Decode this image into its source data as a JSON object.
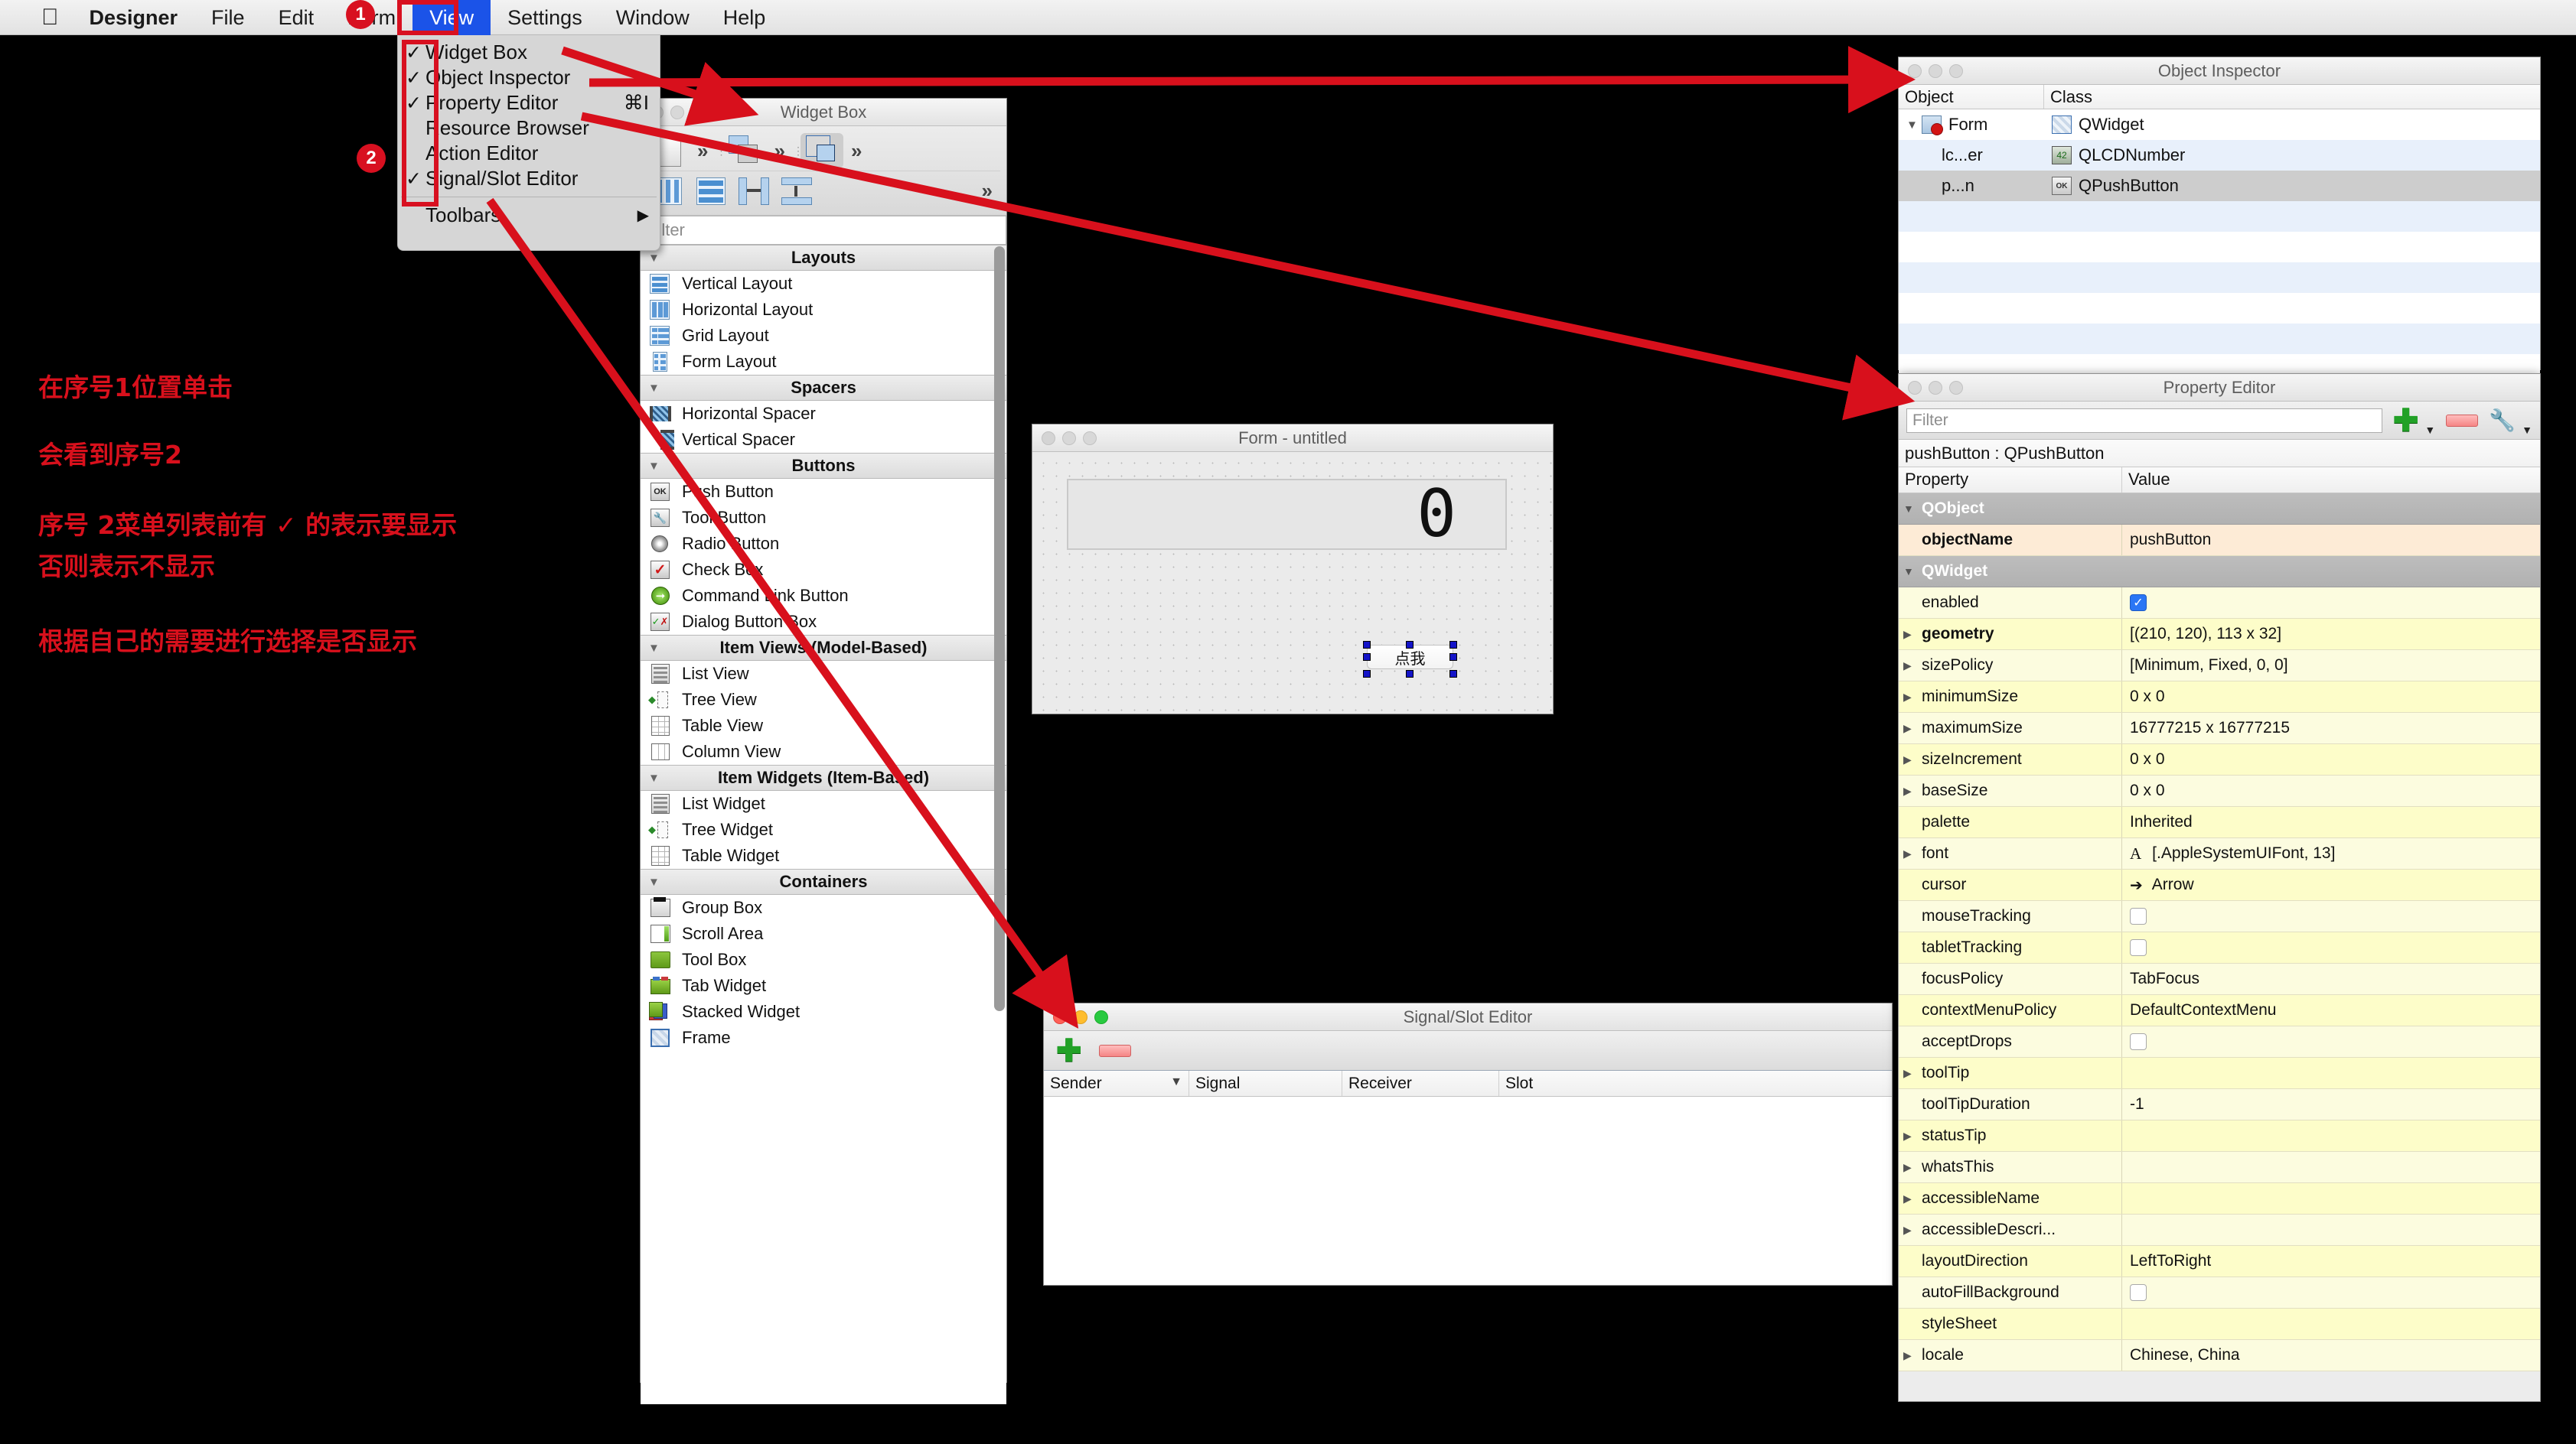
{
  "menubar": {
    "apple_icon": "apple-logo-icon",
    "items": [
      {
        "label": "Designer",
        "bold": true
      },
      {
        "label": "File"
      },
      {
        "label": "Edit"
      },
      {
        "label": "Form"
      },
      {
        "label": "View",
        "selected": true
      },
      {
        "label": "Settings"
      },
      {
        "label": "Window"
      },
      {
        "label": "Help"
      }
    ]
  },
  "badges": {
    "one": "1",
    "two": "2"
  },
  "view_menu": {
    "items": [
      {
        "label": "Widget Box",
        "checked": "✓",
        "shortcut": ""
      },
      {
        "label": "Object Inspector",
        "checked": "✓",
        "shortcut": ""
      },
      {
        "label": "Property Editor",
        "checked": "✓",
        "shortcut": "⌘I"
      },
      {
        "label": "Resource Browser",
        "checked": "",
        "shortcut": ""
      },
      {
        "label": "Action Editor",
        "checked": "",
        "shortcut": ""
      },
      {
        "label": "Signal/Slot Editor",
        "checked": "✓",
        "shortcut": ""
      }
    ],
    "submenu": {
      "label": "Toolbars",
      "arrow": "▶"
    }
  },
  "annotations": {
    "line1": "在序号1位置单击",
    "line2": "会看到序号2",
    "line3": "序号 2菜单列表前有 ✓ 的表示要显示",
    "line4": "否则表示不显示",
    "line5": "根据自己的需要进行选择是否显示",
    "color": "#d8101c"
  },
  "widget_box": {
    "title": "Widget Box",
    "filter_placeholder": "Filter",
    "toolbar_row1": [
      "new-form-icon",
      "chevron-more-icon",
      "raise-widget-icon",
      "chevron-more-icon",
      "edit-widgets-icon",
      "chevron-more-icon"
    ],
    "toolbar_row2": [
      "horizontal-layout-icon",
      "vertical-layout-icon",
      "split-horizontal-icon",
      "split-vertical-icon",
      "chevron-more-icon"
    ],
    "groups": [
      {
        "name": "Layouts",
        "items": [
          {
            "label": "Vertical Layout",
            "icon": "vertical-layout-icon"
          },
          {
            "label": "Horizontal Layout",
            "icon": "horizontal-layout-icon"
          },
          {
            "label": "Grid Layout",
            "icon": "grid-layout-icon"
          },
          {
            "label": "Form Layout",
            "icon": "form-layout-icon"
          }
        ]
      },
      {
        "name": "Spacers",
        "items": [
          {
            "label": "Horizontal Spacer",
            "icon": "horizontal-spacer-icon"
          },
          {
            "label": "Vertical Spacer",
            "icon": "vertical-spacer-icon"
          }
        ]
      },
      {
        "name": "Buttons",
        "items": [
          {
            "label": "Push Button",
            "icon": "push-button-icon"
          },
          {
            "label": "Tool Button",
            "icon": "tool-button-icon"
          },
          {
            "label": "Radio Button",
            "icon": "radio-button-icon"
          },
          {
            "label": "Check Box",
            "icon": "check-box-icon"
          },
          {
            "label": "Command Link Button",
            "icon": "command-link-icon"
          },
          {
            "label": "Dialog Button Box",
            "icon": "dialog-button-box-icon"
          }
        ]
      },
      {
        "name": "Item Views (Model-Based)",
        "items": [
          {
            "label": "List View",
            "icon": "list-view-icon"
          },
          {
            "label": "Tree View",
            "icon": "tree-view-icon"
          },
          {
            "label": "Table View",
            "icon": "table-view-icon"
          },
          {
            "label": "Column View",
            "icon": "column-view-icon"
          }
        ]
      },
      {
        "name": "Item Widgets (Item-Based)",
        "items": [
          {
            "label": "List Widget",
            "icon": "list-widget-icon"
          },
          {
            "label": "Tree Widget",
            "icon": "tree-widget-icon"
          },
          {
            "label": "Table Widget",
            "icon": "table-widget-icon"
          }
        ]
      },
      {
        "name": "Containers",
        "items": [
          {
            "label": "Group Box",
            "icon": "group-box-icon"
          },
          {
            "label": "Scroll Area",
            "icon": "scroll-area-icon"
          },
          {
            "label": "Tool Box",
            "icon": "tool-box-icon"
          },
          {
            "label": "Tab Widget",
            "icon": "tab-widget-icon"
          },
          {
            "label": "Stacked Widget",
            "icon": "stacked-widget-icon"
          },
          {
            "label": "Frame",
            "icon": "frame-icon"
          }
        ]
      }
    ]
  },
  "form_window": {
    "title": "Form - untitled",
    "lcd_value": "0",
    "button_label": "点我"
  },
  "signal_slot_editor": {
    "title": "Signal/Slot Editor",
    "add_icon": "plus-icon",
    "remove_icon": "minus-icon",
    "columns": [
      "Sender",
      "Signal",
      "Receiver",
      "Slot"
    ],
    "sort_arrow": "▼",
    "rows": []
  },
  "object_inspector": {
    "title": "Object Inspector",
    "columns": [
      "Object",
      "Class"
    ],
    "rows": [
      {
        "object": "Form",
        "class": "QWidget",
        "indent": 0,
        "expander": "▼",
        "icon": "form-icon",
        "state": "normal"
      },
      {
        "object": "lc...er",
        "class": "QLCDNumber",
        "indent": 1,
        "expander": "",
        "icon": "lcd-number-icon",
        "state": "alt"
      },
      {
        "object": "p...n",
        "class": "QPushButton",
        "indent": 1,
        "expander": "",
        "icon": "push-button-icon",
        "state": "selected"
      }
    ],
    "empty_rows": 7
  },
  "property_editor": {
    "title": "Property Editor",
    "filter_placeholder": "Filter",
    "add_icon": "plus-icon",
    "remove_icon": "minus-icon",
    "config_icon": "wrench-icon",
    "object_line": "pushButton : QPushButton",
    "columns": [
      "Property",
      "Value"
    ],
    "rows": [
      {
        "kind": "group",
        "name": "QObject",
        "value": "",
        "expander": "▼"
      },
      {
        "kind": "prop",
        "name": "objectName",
        "value": "pushButton",
        "expander": "",
        "bold": true,
        "bg": "peach"
      },
      {
        "kind": "group",
        "name": "QWidget",
        "value": "",
        "expander": "▼"
      },
      {
        "kind": "prop",
        "name": "enabled",
        "value": "",
        "expander": "",
        "bg": "yellow2",
        "widget": "checkbox-on"
      },
      {
        "kind": "prop",
        "name": "geometry",
        "value": "[(210, 120), 113 x 32]",
        "expander": "▶",
        "bold": true,
        "bg": "yellow"
      },
      {
        "kind": "prop",
        "name": "sizePolicy",
        "value": "[Minimum, Fixed, 0, 0]",
        "expander": "▶",
        "bg": "yellow2"
      },
      {
        "kind": "prop",
        "name": "minimumSize",
        "value": "0 x 0",
        "expander": "▶",
        "bg": "yellow"
      },
      {
        "kind": "prop",
        "name": "maximumSize",
        "value": "16777215 x 16777215",
        "expander": "▶",
        "bg": "yellow2"
      },
      {
        "kind": "prop",
        "name": "sizeIncrement",
        "value": "0 x 0",
        "expander": "▶",
        "bg": "yellow"
      },
      {
        "kind": "prop",
        "name": "baseSize",
        "value": "0 x 0",
        "expander": "▶",
        "bg": "yellow2"
      },
      {
        "kind": "prop",
        "name": "palette",
        "value": "Inherited",
        "expander": "",
        "bg": "yellow"
      },
      {
        "kind": "prop",
        "name": "font",
        "value": "[.AppleSystemUIFont, 13]",
        "expander": "▶",
        "bg": "yellow2",
        "widget": "font-glyph"
      },
      {
        "kind": "prop",
        "name": "cursor",
        "value": "Arrow",
        "expander": "",
        "bg": "yellow",
        "widget": "cursor-glyph"
      },
      {
        "kind": "prop",
        "name": "mouseTracking",
        "value": "",
        "expander": "",
        "bg": "yellow2",
        "widget": "checkbox-off"
      },
      {
        "kind": "prop",
        "name": "tabletTracking",
        "value": "",
        "expander": "",
        "bg": "yellow",
        "widget": "checkbox-off"
      },
      {
        "kind": "prop",
        "name": "focusPolicy",
        "value": "TabFocus",
        "expander": "",
        "bg": "yellow2"
      },
      {
        "kind": "prop",
        "name": "contextMenuPolicy",
        "value": "DefaultContextMenu",
        "expander": "",
        "bg": "yellow"
      },
      {
        "kind": "prop",
        "name": "acceptDrops",
        "value": "",
        "expander": "",
        "bg": "yellow2",
        "widget": "checkbox-off"
      },
      {
        "kind": "prop",
        "name": "toolTip",
        "value": "",
        "expander": "▶",
        "bg": "yellow"
      },
      {
        "kind": "prop",
        "name": "toolTipDuration",
        "value": "-1",
        "expander": "",
        "bg": "yellow2"
      },
      {
        "kind": "prop",
        "name": "statusTip",
        "value": "",
        "expander": "▶",
        "bg": "yellow"
      },
      {
        "kind": "prop",
        "name": "whatsThis",
        "value": "",
        "expander": "▶",
        "bg": "yellow2"
      },
      {
        "kind": "prop",
        "name": "accessibleName",
        "value": "",
        "expander": "▶",
        "bg": "yellow"
      },
      {
        "kind": "prop",
        "name": "accessibleDescri...",
        "value": "",
        "expander": "▶",
        "bg": "yellow2"
      },
      {
        "kind": "prop",
        "name": "layoutDirection",
        "value": "LeftToRight",
        "expander": "",
        "bg": "yellow"
      },
      {
        "kind": "prop",
        "name": "autoFillBackground",
        "value": "",
        "expander": "",
        "bg": "yellow2",
        "widget": "checkbox-off"
      },
      {
        "kind": "prop",
        "name": "styleSheet",
        "value": "",
        "expander": "",
        "bg": "yellow"
      },
      {
        "kind": "prop",
        "name": "locale",
        "value": "Chinese, China",
        "expander": "▶",
        "bg": "yellow2"
      }
    ]
  }
}
